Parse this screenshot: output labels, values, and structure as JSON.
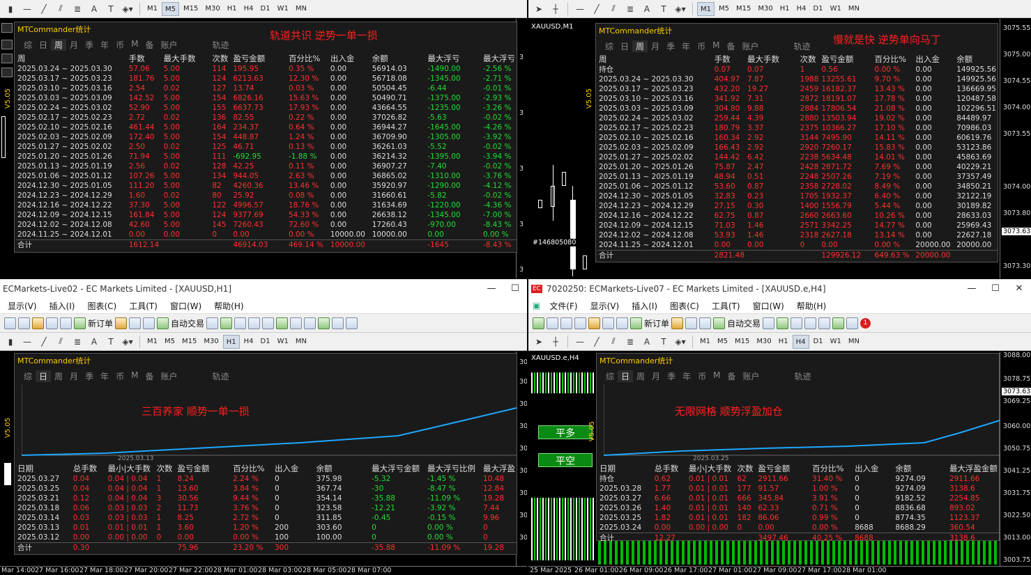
{
  "tl": {
    "timeframes": [
      "M1",
      "M5",
      "M15",
      "M30",
      "H1",
      "H4",
      "D1",
      "W1",
      "MN"
    ],
    "active": "M5",
    "panel": {
      "title": "MTCommander统计",
      "tabs": [
        "综",
        "日",
        "周",
        "月",
        "季",
        "年",
        "币",
        "M",
        "备",
        "账户"
      ],
      "tab_active": "周",
      "tab_extra": "轨迹",
      "overlay": "轨道共识 逆势一单一损",
      "version": "V5.05"
    },
    "headers": [
      "周",
      "手数",
      "最大手数",
      "次数",
      "盈亏金额",
      "百分比%",
      "出入金",
      "余额",
      "最大浮亏",
      "最大浮亏"
    ],
    "rows": [
      [
        "2025.03.24 ~ 2025.03.30",
        "57.06",
        "5.00",
        "114",
        "195.95",
        "0.35 %",
        "0.00",
        "56914.03",
        "-1490.00",
        "-2.56 %"
      ],
      [
        "2025.03.17 ~ 2025.03.23",
        "181.76",
        "5.00",
        "124",
        "6213.63",
        "12.30 %",
        "0.00",
        "56718.08",
        "-1345.00",
        "-2.71 %"
      ],
      [
        "2025.03.10 ~ 2025.03.16",
        "2.54",
        "0.02",
        "127",
        "13.74",
        "0.03 %",
        "0.00",
        "50504.45",
        "-6.44",
        "-0.01 %"
      ],
      [
        "2025.03.03 ~ 2025.03.09",
        "142.52",
        "5.00",
        "154",
        "6826.16",
        "15.63 %",
        "0.00",
        "50490.71",
        "-1375.00",
        "-2.93 %"
      ],
      [
        "2025.02.24 ~ 2025.03.02",
        "52.90",
        "5.00",
        "155",
        "6637.73",
        "17.93 %",
        "0.00",
        "43664.55",
        "-1235.00",
        "-3.26 %"
      ],
      [
        "2025.02.17 ~ 2025.02.23",
        "2.72",
        "0.02",
        "136",
        "82.55",
        "0.22 %",
        "0.00",
        "37026.82",
        "-5.63",
        "-0.02 %"
      ],
      [
        "2025.02.10 ~ 2025.02.16",
        "461.44",
        "5.00",
        "164",
        "234.37",
        "0.64 %",
        "0.00",
        "36944.27",
        "-1645.00",
        "-4.26 %"
      ],
      [
        "2025.02.03 ~ 2025.02.09",
        "172.40",
        "5.00",
        "154",
        "448.87",
        "1.24 %",
        "0.00",
        "36709.90",
        "-1305.00",
        "-3.92 %"
      ],
      [
        "2025.01.27 ~ 2025.02.02",
        "2.50",
        "0.02",
        "125",
        "46.71",
        "0.13 %",
        "0.00",
        "36261.03",
        "-5.52",
        "-0.02 %"
      ],
      [
        "2025.01.20 ~ 2025.01.26",
        "71.94",
        "5.00",
        "111",
        "-692.95",
        "-1.88 %",
        "0.00",
        "36214.32",
        "-1395.00",
        "-3.94 %"
      ],
      [
        "2025.01.13 ~ 2025.01.19",
        "2.56",
        "0.02",
        "128",
        "42.25",
        "0.11 %",
        "0.00",
        "36907.27",
        "-7.40",
        "-0.02 %"
      ],
      [
        "2025.01.06 ~ 2025.01.12",
        "107.26",
        "5.00",
        "134",
        "944.05",
        "2.63 %",
        "0.00",
        "36865.02",
        "-1310.00",
        "-3.76 %"
      ],
      [
        "2024.12.30 ~ 2025.01.05",
        "111.20",
        "5.00",
        "82",
        "4260.36",
        "13.46 %",
        "0.00",
        "35920.97",
        "-1290.00",
        "-4.12 %"
      ],
      [
        "2024.12.23 ~ 2024.12.29",
        "1.60",
        "0.02",
        "80",
        "25.92",
        "0.08 %",
        "0.00",
        "31660.61",
        "-5.82",
        "-0.02 %"
      ],
      [
        "2024.12.16 ~ 2024.12.22",
        "37.30",
        "5.00",
        "122",
        "4996.57",
        "18.76 %",
        "0.00",
        "31634.69",
        "-1220.00",
        "-4.36 %"
      ],
      [
        "2024.12.09 ~ 2024.12.15",
        "161.84",
        "5.00",
        "124",
        "9377.69",
        "54.33 %",
        "0.00",
        "26638.12",
        "-1345.00",
        "-7.00 %"
      ],
      [
        "2024.12.02 ~ 2024.12.08",
        "42.60",
        "5.00",
        "145",
        "7260.43",
        "72.60 %",
        "0.00",
        "17260.43",
        "-970.00",
        "-8.43 %"
      ],
      [
        "2024.11.25 ~ 2024.12.01",
        "0.00",
        "0.00",
        "0",
        "0.00",
        "0.00 %",
        "10000.00",
        "10000.00",
        "0.00",
        "0.00 %"
      ]
    ],
    "total": [
      "合计",
      "1612.14",
      "",
      "",
      "46914.03",
      "469.14 %",
      "10000.00",
      "",
      "-1645",
      "-8.43 %"
    ],
    "axis": [
      "3"
    ]
  },
  "tr": {
    "symbol": "XAUUSD,M1",
    "timeframes": [
      "M1",
      "M5",
      "M15",
      "M30",
      "H1",
      "H4",
      "D1",
      "W1",
      "MN"
    ],
    "panel": {
      "title": "MTCommander统计",
      "tabs": [
        "综",
        "日",
        "周",
        "月",
        "季",
        "年",
        "币",
        "M",
        "备",
        "账户"
      ],
      "tab_active": "周",
      "tab_extra": "轨迹",
      "overlay": "慢就是快 逆势单向马丁",
      "version": "V5.05"
    },
    "headers": [
      "周",
      "手数",
      "最大手数",
      "次数",
      "盈亏金额",
      "百分比%",
      "出入金",
      "余额"
    ],
    "rows": [
      [
        "持仓",
        "0.07",
        "0.07",
        "1",
        "0.56",
        "0.00 %",
        "0.00",
        "149925.56"
      ],
      [
        "2025.03.24 ~ 2025.03.30",
        "404.97",
        "7.87",
        "1988",
        "13255.61",
        "9.70 %",
        "0.00",
        "149925.56"
      ],
      [
        "2025.03.17 ~ 2025.03.23",
        "432.20",
        "19.27",
        "2459",
        "16182.37",
        "13.43 %",
        "0.00",
        "136669.95"
      ],
      [
        "2025.03.10 ~ 2025.03.16",
        "341.92",
        "7.31",
        "2872",
        "18191.07",
        "17.78 %",
        "0.00",
        "120487.58"
      ],
      [
        "2025.03.03 ~ 2025.03.09",
        "304.80",
        "9.88",
        "2884",
        "17806.54",
        "21.08 %",
        "0.00",
        "102296.51"
      ],
      [
        "2025.02.24 ~ 2025.03.02",
        "259.44",
        "4.39",
        "2880",
        "13503.94",
        "19.02 %",
        "0.00",
        "84489.97"
      ],
      [
        "2025.02.17 ~ 2025.02.23",
        "180.79",
        "3.37",
        "2375",
        "10366.27",
        "17.10 %",
        "0.00",
        "70986.03"
      ],
      [
        "2025.02.10 ~ 2025.02.16",
        "160.34",
        "2.92",
        "3144",
        "7495.90",
        "14.11 %",
        "0.00",
        "60619.76"
      ],
      [
        "2025.02.03 ~ 2025.02.09",
        "166.43",
        "2.92",
        "2920",
        "7260.17",
        "15.83 %",
        "0.00",
        "53123.86"
      ],
      [
        "2025.01.27 ~ 2025.02.02",
        "144.42",
        "6.42",
        "2238",
        "5634.48",
        "14.01 %",
        "0.00",
        "45863.69"
      ],
      [
        "2025.01.20 ~ 2025.01.26",
        "75.87",
        "2.47",
        "2428",
        "2871.72",
        "7.69 %",
        "0.00",
        "40229.21"
      ],
      [
        "2025.01.13 ~ 2025.01.19",
        "48.94",
        "0.51",
        "2248",
        "2507.26",
        "7.19 %",
        "0.00",
        "37357.49"
      ],
      [
        "2025.01.06 ~ 2025.01.12",
        "53.60",
        "0.87",
        "2358",
        "2728.02",
        "8.49 %",
        "0.00",
        "34850.21"
      ],
      [
        "2024.12.30 ~ 2025.01.05",
        "32.83",
        "0.23",
        "1705",
        "1932.37",
        "6.40 %",
        "0.00",
        "32122.19"
      ],
      [
        "2024.12.23 ~ 2024.12.29",
        "27.15",
        "0.30",
        "1400",
        "1556.79",
        "5.44 %",
        "0.00",
        "30189.82"
      ],
      [
        "2024.12.16 ~ 2024.12.22",
        "62.75",
        "0.87",
        "2660",
        "2663.60",
        "10.26 %",
        "0.00",
        "28633.03"
      ],
      [
        "2024.12.09 ~ 2024.12.15",
        "71.03",
        "1.46",
        "2571",
        "3342.25",
        "14.77 %",
        "0.00",
        "25969.43"
      ],
      [
        "2024.12.02 ~ 2024.12.08",
        "53.93",
        "1.46",
        "2318",
        "2627.18",
        "13.14 %",
        "0.00",
        "22627.18"
      ],
      [
        "2024.11.25 ~ 2024.12.01",
        "0.00",
        "0.00",
        "0",
        "0.00",
        "0.00 %",
        "20000.00",
        "20000.00"
      ]
    ],
    "total": [
      "合计",
      "2821.48",
      "",
      "",
      "129926.12",
      "649.63 %",
      "20000.00",
      ""
    ],
    "axis": [
      "3075.55",
      "3075.00",
      "3074.55",
      "3074.00",
      "3074.55",
      "3074.00",
      "3073.55",
      "3073.63",
      "3073.30"
    ],
    "axis_labels": [
      "3075.55",
      "3075.00",
      "3074.55",
      "3074.00",
      "3073.55",
      "3074.00",
      "3073.80",
      "3073.63",
      "3073.30"
    ],
    "ticket": "#146805080"
  },
  "bl": {
    "title": "ECMarkets-Live02 - EC Markets Limited - [XAUUSD,H1]",
    "menu": [
      "显示(V)",
      "插入(I)",
      "图表(C)",
      "工具(T)",
      "窗口(W)",
      "帮助(H)"
    ],
    "btn_order": "新订单",
    "btn_auto": "自动交易",
    "timeframes": [
      "M1",
      "M5",
      "M15",
      "M30",
      "H1",
      "H4",
      "D1",
      "W1",
      "MN"
    ],
    "active": "H1",
    "panel": {
      "title": "MTCommander统计",
      "tabs": [
        "综",
        "日",
        "周",
        "月",
        "季",
        "年",
        "币",
        "M",
        "备",
        "账户"
      ],
      "tab_active": "日",
      "tab_extra": "轨迹",
      "overlay": "三百养家 顺势一单一损",
      "version": "V5.05",
      "chart_date": "2025.03.13"
    },
    "headers": [
      "日期",
      "总手数",
      "最小|大手数",
      "次数",
      "盈亏金额",
      "百分比%",
      "出入金",
      "余额",
      "最大浮亏金额",
      "最大浮亏比例",
      "最大浮盈"
    ],
    "rows": [
      [
        "2025.03.27",
        "0.04",
        "0.04 | 0.04",
        "1",
        "8.24",
        "2.24 %",
        "0",
        "375.98",
        "-5.32",
        "-1.45 %",
        "10.48"
      ],
      [
        "2025.03.25",
        "0.04",
        "0.04 | 0.04",
        "1",
        "13.60",
        "3.84 %",
        "0",
        "367.74",
        "-30",
        "-8.47 %",
        "12.84"
      ],
      [
        "2025.03.21",
        "0.12",
        "0.04 | 0.04",
        "3",
        "30.56",
        "9.44 %",
        "0",
        "354.14",
        "-35.88",
        "-11.09 %",
        "19.28"
      ],
      [
        "2025.03.18",
        "0.06",
        "0.03 | 0.03",
        "2",
        "11.73",
        "3.76 %",
        "0",
        "323.58",
        "-12.21",
        "-3.92 %",
        "7.44"
      ],
      [
        "2025.03.14",
        "0.03",
        "0.03 | 0.03",
        "1",
        "8.25",
        "2.72 %",
        "0",
        "311.85",
        "-0.45",
        "-0.15 %",
        "9.96"
      ],
      [
        "2025.03.13",
        "0.01",
        "0.01 | 0.01",
        "1",
        "3.60",
        "1.20 %",
        "200",
        "303.60",
        "0",
        "0.00 %",
        "0"
      ],
      [
        "2025.03.12",
        "0.00",
        "0.00 | 0.00",
        "0",
        "0.00",
        "0.00 %",
        "100",
        "100.00",
        "0",
        "0.00 %",
        "0"
      ]
    ],
    "total": [
      "合计",
      "0.30",
      "",
      "",
      "75.96",
      "23.20 %",
      "300",
      "",
      "-35.88",
      "-11.09 %",
      "19.28"
    ],
    "xaxis": [
      "Mar 14:00",
      "27 Mar 16:00",
      "27 Mar 18:00",
      "27 Mar 20:00",
      "27 Mar 22:00",
      "28 Mar 01:00",
      "28 Mar 03:00",
      "28 Mar 05:00",
      "28 Mar 07:00"
    ],
    "axis": [
      "30"
    ]
  },
  "br": {
    "title": "7020250: ECMarkets-Live07 - EC Markets Limited - [XAUUSD.e,H4]",
    "app_badge": "EC",
    "menu": [
      "文件(F)",
      "显示(V)",
      "插入(I)",
      "图表(C)",
      "工具(T)",
      "窗口(W)",
      "帮助(H)"
    ],
    "btn_order": "新订单",
    "btn_auto": "自动交易",
    "notif": "1",
    "timeframes": [
      "M1",
      "M5",
      "M15",
      "M30",
      "H1",
      "H4",
      "D1",
      "W1",
      "MN"
    ],
    "active": "H4",
    "symbol": "XAUUSD.e,H4",
    "btn_close_long": "平多",
    "btn_close_short": "平空",
    "panel": {
      "title": "MTCommander统计",
      "tabs": [
        "综",
        "日",
        "周",
        "月",
        "季",
        "年",
        "币",
        "M",
        "备",
        "账户"
      ],
      "tab_active": "日",
      "tab_extra": "轨迹",
      "overlay": "无限网格 顺势浮盈加仓",
      "version": "V5.05",
      "chart_date": "2025.03.25"
    },
    "headers": [
      "日期",
      "总手数",
      "最小|大手数",
      "次数",
      "盈亏金额",
      "百分比%",
      "出入金",
      "余额",
      "最大浮盈金额"
    ],
    "rows": [
      [
        "持仓",
        "0.62",
        "0.01 | 0.01",
        "62",
        "2911.66",
        "31.40 %",
        "0",
        "9274.09",
        "2911.66"
      ],
      [
        "2025.03.28",
        "1.77",
        "0.01 | 0.01",
        "177",
        "91.57",
        "1.00 %",
        "0",
        "9274.09",
        "3138.6"
      ],
      [
        "2025.03.27",
        "6.66",
        "0.01 | 0.01",
        "666",
        "345.84",
        "3.91 %",
        "0",
        "9182.52",
        "2254.85"
      ],
      [
        "2025.03.26",
        "1.40",
        "0.01 | 0.01",
        "140",
        "62.33",
        "0.71 %",
        "0",
        "8836.68",
        "893.02"
      ],
      [
        "2025.03.25",
        "1.82",
        "0.01 | 0.01",
        "182",
        "86.06",
        "0.99 %",
        "0",
        "8774.35",
        "1123.37"
      ],
      [
        "2025.03.24",
        "0.00",
        "0.00 | 0.00",
        "0",
        "0.00",
        "0.00 %",
        "8688",
        "8688.29",
        "360.54"
      ]
    ],
    "total": [
      "合计",
      "12.27",
      "",
      "",
      "3497.46",
      "40.25 %",
      "8688",
      "",
      "3138.6"
    ],
    "axis": [
      "3088.00",
      "3078.75",
      "3073.63",
      "3069.25",
      "3060.00",
      "3050.75",
      "3041.25",
      "3031.75",
      "3022.50",
      "3013.00",
      "3003.75"
    ],
    "xaxis": [
      "25 Mar 2025",
      "26 Mar 01:00",
      "26 Mar 09:00",
      "26 Mar 17:00",
      "27 Mar 01:00",
      "27 Mar 09:00",
      "27 Mar 17:00",
      "28 Mar 01:00"
    ]
  },
  "colors": {
    "loss": "#ff3030",
    "gain": "#22dd33",
    "title": "#ffcc00",
    "overlay": "#ff2020",
    "curve": "#1ea7ff"
  }
}
